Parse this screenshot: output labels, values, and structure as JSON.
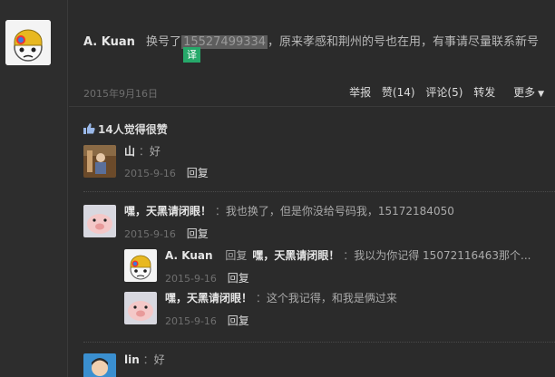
{
  "post": {
    "author": "A. Kuan",
    "text_before": "换号了",
    "phone": "15527499334",
    "text_after": "，原来孝感和荆州的号也在用，有事请尽量联系新号",
    "translate_label": "译",
    "date": "2015年9月16日",
    "actions": {
      "report": "举报",
      "like": "赞(14)",
      "comment": "评论(5)",
      "share": "转发",
      "more": "更多"
    }
  },
  "likes_text": "14人觉得很赞",
  "reply_label": "回复",
  "comments": [
    {
      "name": "山",
      "sep": "：",
      "text": "好",
      "date": "2015-9-16"
    },
    {
      "name": "嘿，天黑请闭眼！",
      "sep": "：",
      "text": "我也换了，但是你没给号码我，15172184050",
      "date": "2015-9-16"
    },
    {
      "name": "A. Kuan",
      "reply_to_label": "回复",
      "reply_to": "嘿，天黑请闭眼！",
      "sep": "：",
      "text": "我以为你记得 15072116463那个...",
      "date": "2015-9-16"
    },
    {
      "name": "嘿，天黑请闭眼！",
      "sep": "：",
      "text": "这个我记得，和我是俩过来",
      "date": "2015-9-16"
    },
    {
      "name": "lin",
      "sep": "：",
      "text": "好"
    }
  ]
}
